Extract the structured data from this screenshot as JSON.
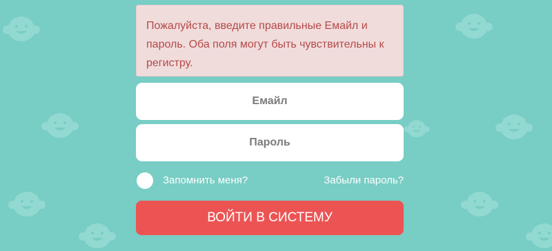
{
  "alert": {
    "message": "Пожалуйста, введите правильные Емайл и пароль. Оба поля могут быть чувствительны к регистру."
  },
  "form": {
    "email_placeholder": "Емайл",
    "password_placeholder": "Пароль",
    "remember_label": "Запомнить меня?",
    "forgot_link": "Забыли пароль?",
    "submit_label": "ВОЙТИ В СИСТЕМУ"
  },
  "colors": {
    "background": "#78cdc5",
    "alert_background": "#f1dcdc",
    "alert_text": "#b44a48",
    "button": "#ec5454"
  },
  "background_icon": "cartoon-kid-face-icon"
}
